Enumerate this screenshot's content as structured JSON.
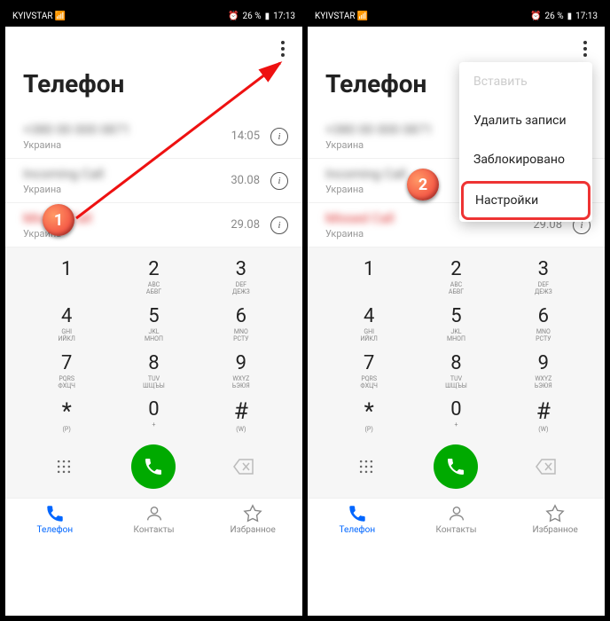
{
  "status": {
    "carrier": "KYIVSTAR",
    "battery": "26 %",
    "time": "17:13"
  },
  "page_title": "Телефон",
  "calls": [
    {
      "name": "+380 00 000 0871",
      "sub": "Украина",
      "time": "14:05",
      "missed": false
    },
    {
      "name": "Incoming Call",
      "sub": "Украина",
      "time": "30.08",
      "missed": false
    },
    {
      "name": "Missed Call",
      "sub": "Украина",
      "time": "29.08",
      "missed": true
    }
  ],
  "dialpad": {
    "keys": [
      [
        {
          "n": "1",
          "s": "",
          "r": ""
        },
        {
          "n": "2",
          "s": "ABC",
          "r": "АБВГ"
        },
        {
          "n": "3",
          "s": "DEF",
          "r": "ДЕЖЗ"
        }
      ],
      [
        {
          "n": "4",
          "s": "GHI",
          "r": "ИЙКЛ"
        },
        {
          "n": "5",
          "s": "JKL",
          "r": "МНОП"
        },
        {
          "n": "6",
          "s": "MNO",
          "r": "РСТУ"
        }
      ],
      [
        {
          "n": "7",
          "s": "PQRS",
          "r": "ФХЦЧ"
        },
        {
          "n": "8",
          "s": "TUV",
          "r": "ШЩЪЫ"
        },
        {
          "n": "9",
          "s": "WXYZ",
          "r": "ЬЭЮЯ"
        }
      ],
      [
        {
          "n": "*",
          "s": "(P)",
          "r": ""
        },
        {
          "n": "0",
          "s": "+",
          "r": ""
        },
        {
          "n": "#",
          "s": "(W)",
          "r": ""
        }
      ]
    ]
  },
  "nav": {
    "phone": "Телефон",
    "contacts": "Контакты",
    "favorites": "Избранное"
  },
  "menu": {
    "paste": "Вставить",
    "delete": "Удалить записи",
    "blocked": "Заблокировано",
    "settings": "Настройки"
  },
  "markers": {
    "m1": "1",
    "m2": "2"
  }
}
